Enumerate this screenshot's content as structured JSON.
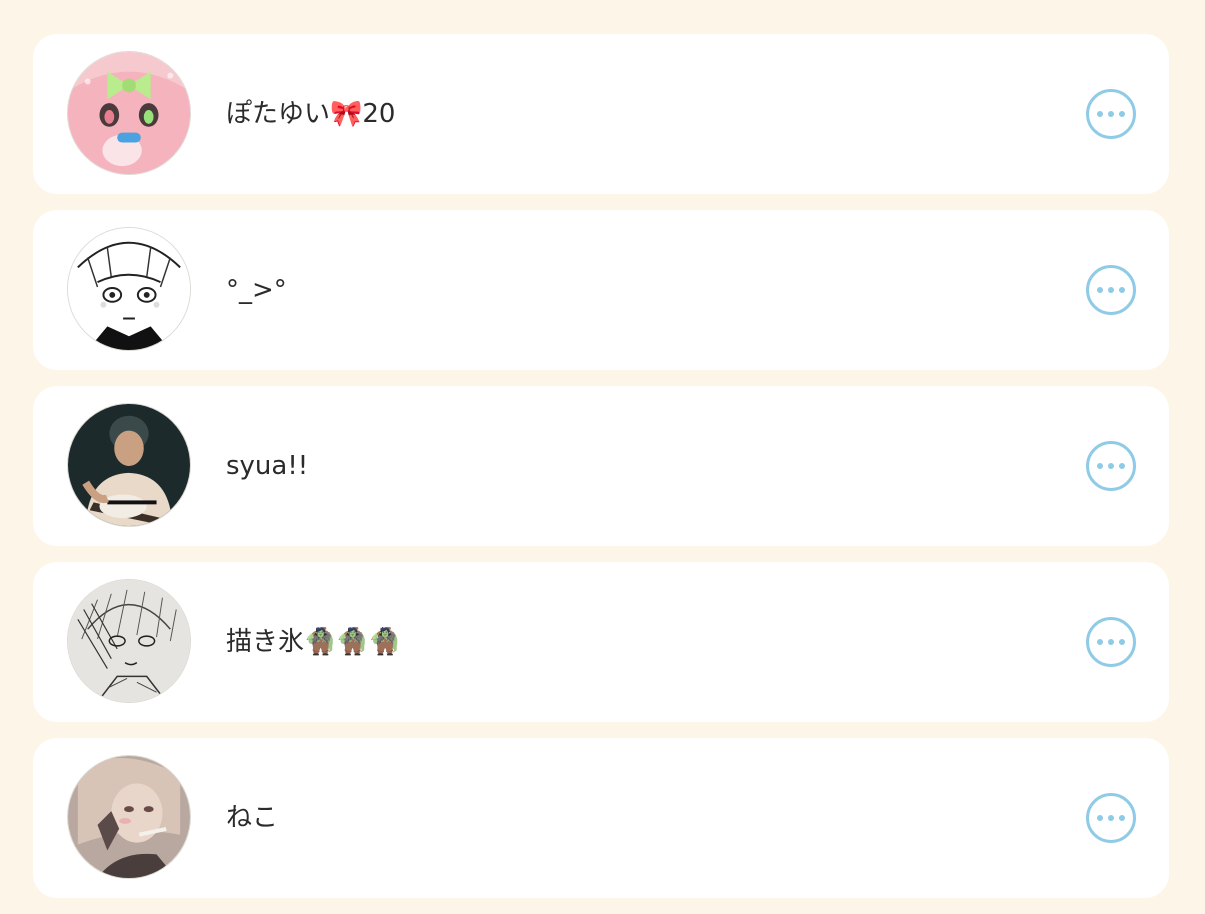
{
  "users": [
    {
      "name": "ぽたゆい🎀20",
      "avatar": "avatar-anime-pink-bow"
    },
    {
      "name": "°_>°",
      "avatar": "avatar-manga-sketch"
    },
    {
      "name": "syua!!",
      "avatar": "avatar-guitar-photo"
    },
    {
      "name": "描き氷🧌🧌🧌",
      "avatar": "avatar-pencil-sketch"
    },
    {
      "name": "ねこ",
      "avatar": "avatar-sepia-illustration"
    }
  ],
  "colors": {
    "background": "#fdf6e8",
    "card": "#ffffff",
    "accent": "#8fcbe6",
    "text": "#2b2b2b"
  },
  "icons": {
    "more": "more-options-icon"
  }
}
